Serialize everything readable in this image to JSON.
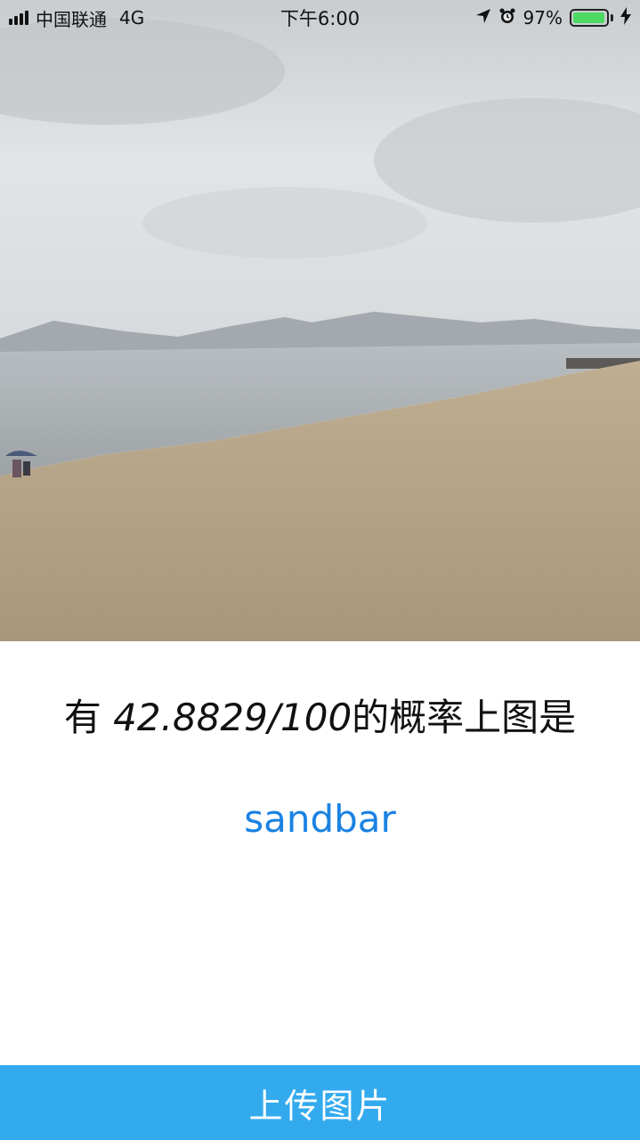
{
  "status_bar": {
    "carrier": "中国联通",
    "network": "4G",
    "time": "下午6:00",
    "battery_percent_text": "97%",
    "battery_level": 0.97
  },
  "photo": {
    "icon": "beach-photo"
  },
  "result": {
    "prefix": "有 ",
    "probability": "42.8829/100",
    "suffix": "的概率上图是",
    "label": "sandbar",
    "label_color": "#1a82e2"
  },
  "actions": {
    "upload_label": "上传图片",
    "button_color": "#33aaee"
  }
}
